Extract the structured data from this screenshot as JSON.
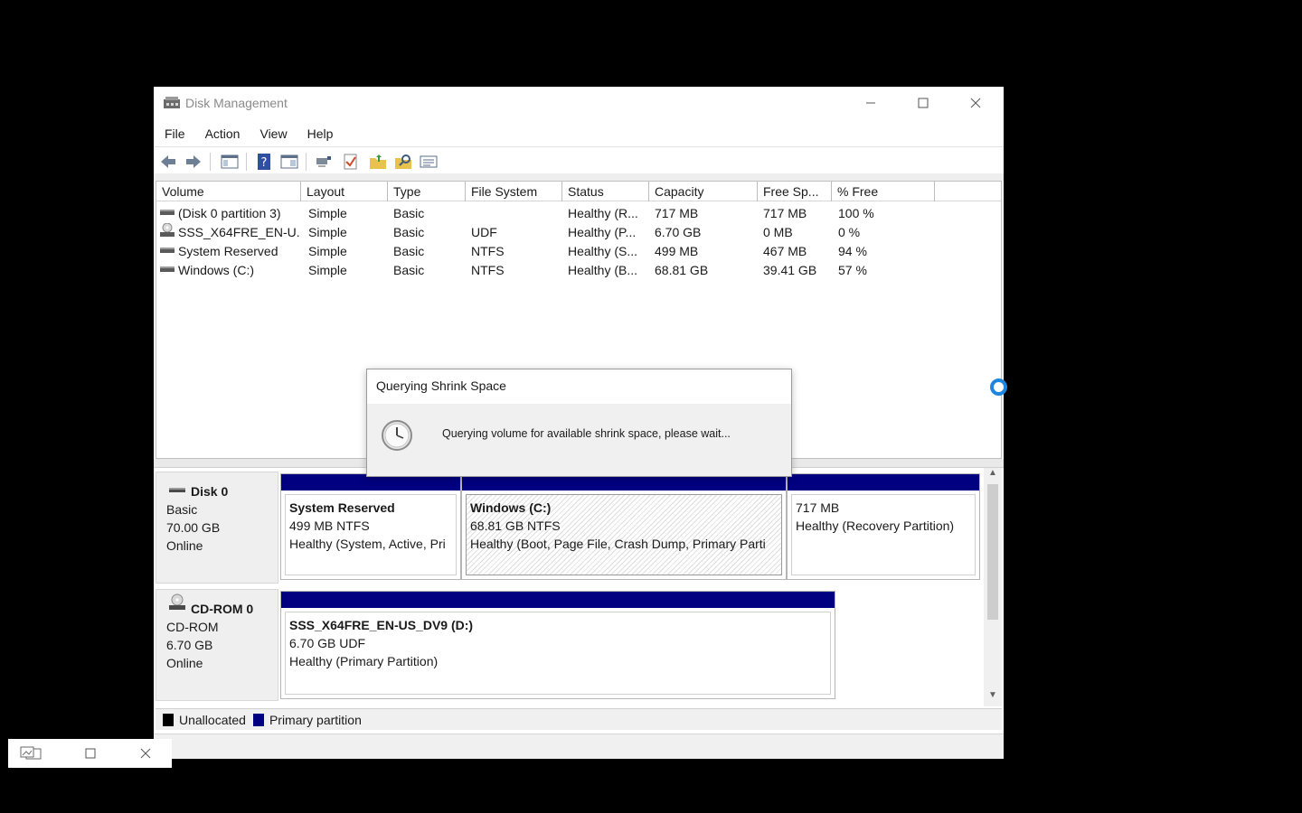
{
  "window": {
    "title": "Disk Management"
  },
  "menu": [
    "File",
    "Action",
    "View",
    "Help"
  ],
  "toolbar": [
    "back-icon",
    "forward-icon",
    "console-tree-icon",
    "help-icon",
    "properties-icon",
    "connect-icon",
    "check-icon",
    "new-folder-icon",
    "search-folder-icon",
    "list-view-icon"
  ],
  "volumes": {
    "columns": [
      "Volume",
      "Layout",
      "Type",
      "File System",
      "Status",
      "Capacity",
      "Free Sp...",
      "% Free"
    ],
    "rows": [
      {
        "volume": "(Disk 0 partition 3)",
        "layout": "Simple",
        "type": "Basic",
        "fs": "",
        "status": "Healthy (R...",
        "capacity": "717 MB",
        "free": "717 MB",
        "pct": "100 %"
      },
      {
        "volume": "SSS_X64FRE_EN-U...",
        "layout": "Simple",
        "type": "Basic",
        "fs": "UDF",
        "status": "Healthy (P...",
        "capacity": "6.70 GB",
        "free": "0 MB",
        "pct": "0 %"
      },
      {
        "volume": "System Reserved",
        "layout": "Simple",
        "type": "Basic",
        "fs": "NTFS",
        "status": "Healthy (S...",
        "capacity": "499 MB",
        "free": "467 MB",
        "pct": "94 %"
      },
      {
        "volume": "Windows (C:)",
        "layout": "Simple",
        "type": "Basic",
        "fs": "NTFS",
        "status": "Healthy (B...",
        "capacity": "68.81 GB",
        "free": "39.41 GB",
        "pct": "57 %"
      }
    ]
  },
  "disks": [
    {
      "name": "Disk 0",
      "type": "Basic",
      "size": "70.00 GB",
      "state": "Online",
      "partitions": [
        {
          "title": "System Reserved",
          "detail": "499 MB NTFS",
          "status": "Healthy (System, Active, Pri"
        },
        {
          "title": "Windows  (C:)",
          "detail": "68.81 GB NTFS",
          "status": "Healthy (Boot, Page File, Crash Dump, Primary Parti"
        },
        {
          "title": "",
          "detail": "717 MB",
          "status": "Healthy (Recovery Partition)"
        }
      ]
    },
    {
      "name": "CD-ROM 0",
      "type": "CD-ROM",
      "size": "6.70 GB",
      "state": "Online",
      "partitions": [
        {
          "title": "SSS_X64FRE_EN-US_DV9  (D:)",
          "detail": "6.70 GB UDF",
          "status": "Healthy (Primary Partition)"
        }
      ]
    }
  ],
  "legend": [
    {
      "label": "Unallocated",
      "color": "#000000"
    },
    {
      "label": "Primary partition",
      "color": "#000080"
    }
  ],
  "dialog": {
    "title": "Querying Shrink Space",
    "message": "Querying volume for available shrink space, please wait..."
  },
  "colors": {
    "primary": "#000080",
    "accent": "#1f86e0"
  }
}
